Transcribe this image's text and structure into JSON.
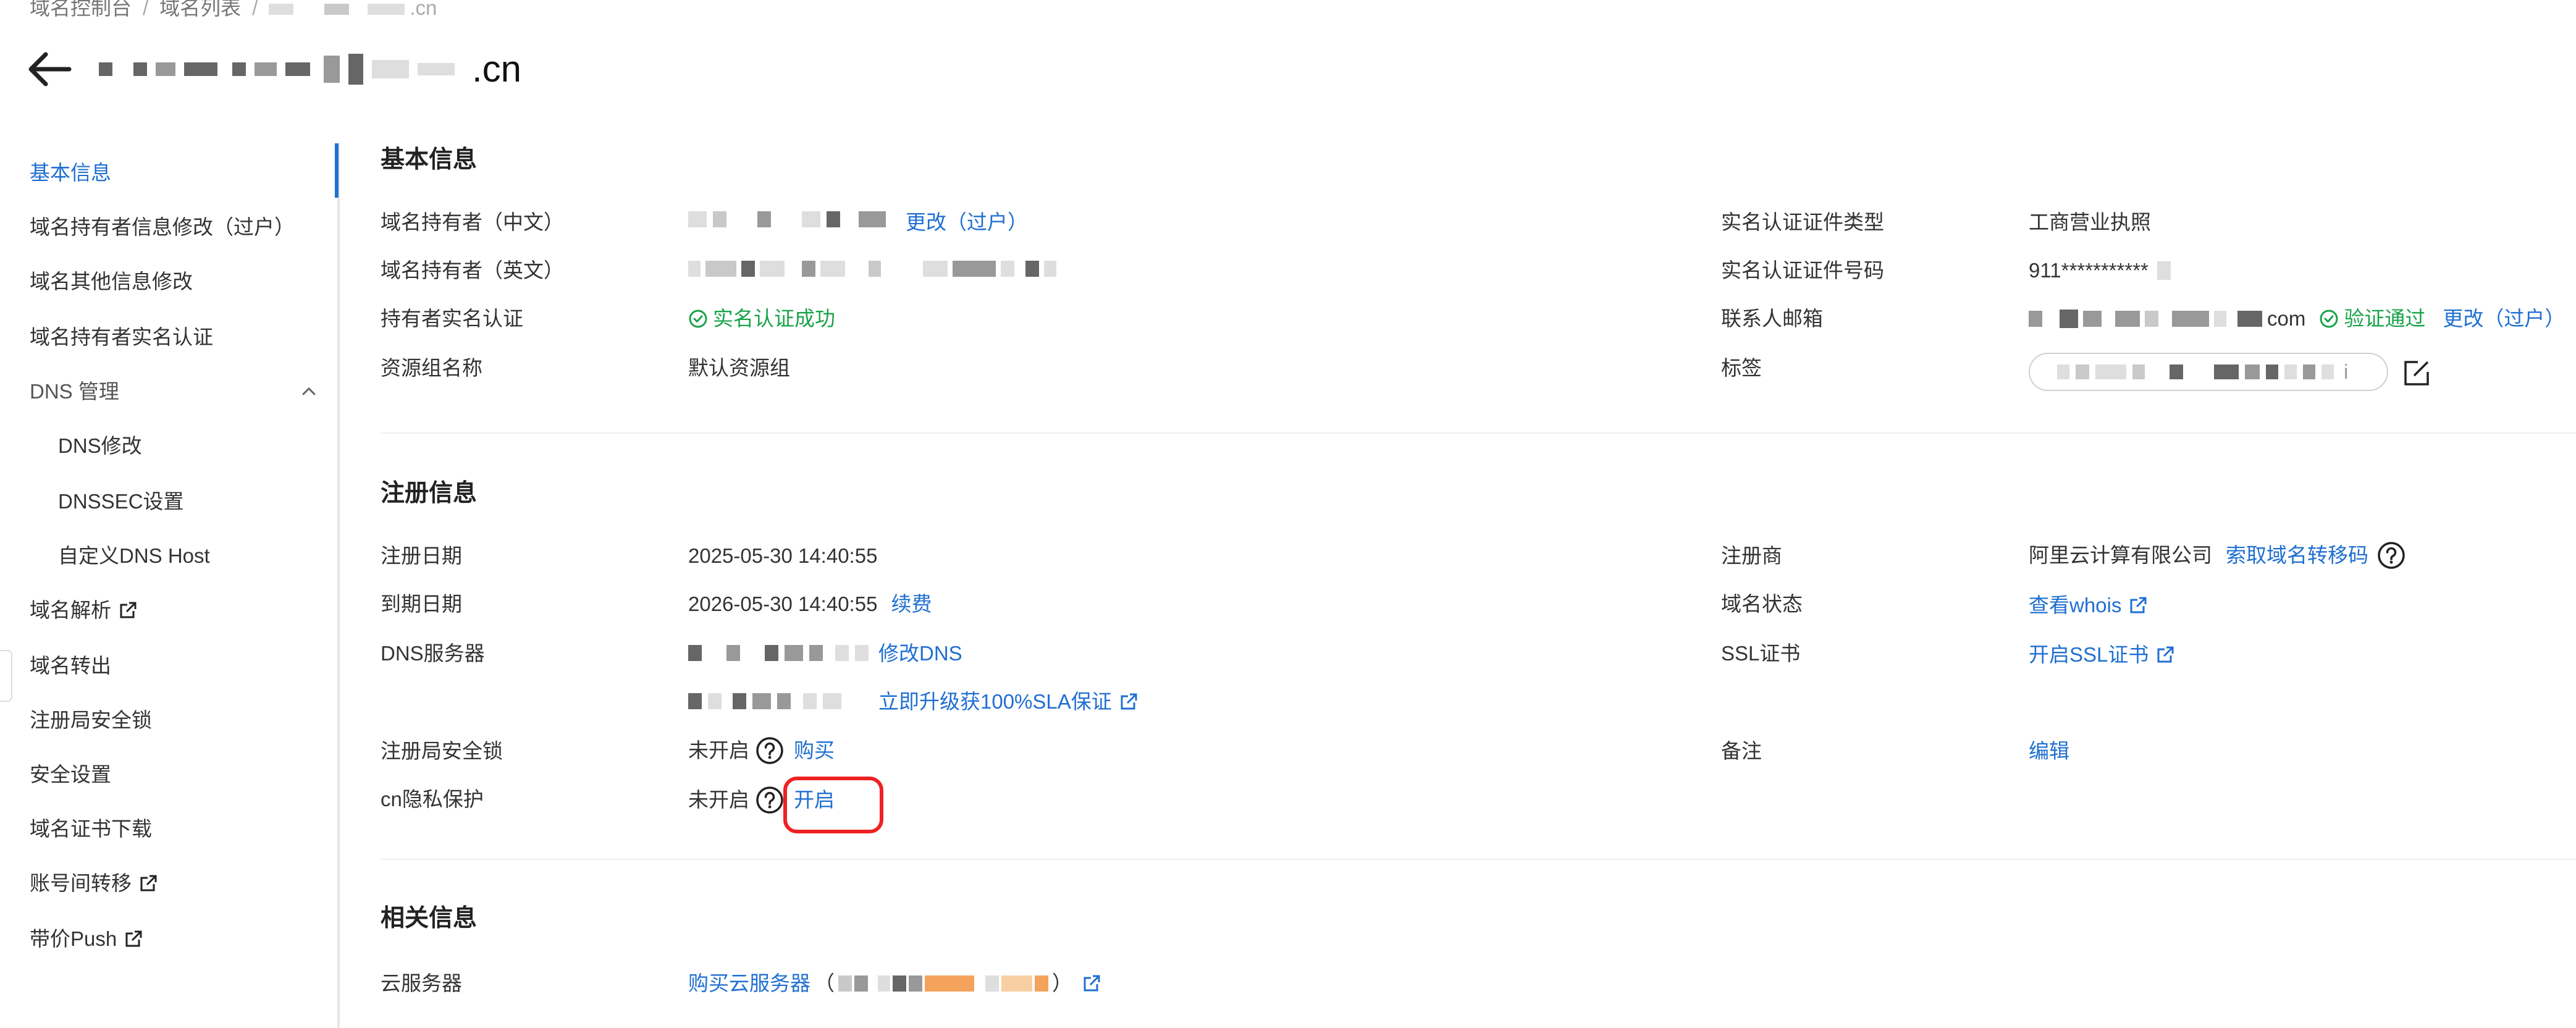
{
  "breadcrumb": {
    "item1": "域名控制台",
    "separator": "/",
    "item2": "域名列表",
    "item3_suffix": ".cn"
  },
  "header": {
    "title_suffix": ".cn"
  },
  "sidebar": {
    "items": [
      "基本信息",
      "域名持有者信息修改（过户）",
      "域名其他信息修改",
      "域名持有者实名认证",
      "DNS 管理",
      "DNS修改",
      "DNSSEC设置",
      "自定义DNS Host",
      "域名解析",
      "域名转出",
      "注册局安全锁",
      "安全设置",
      "域名证书下载",
      "账号间转移",
      "带价Push"
    ]
  },
  "basic": {
    "section_title": "基本信息",
    "owner_cn_label": "域名持有者（中文）",
    "owner_cn_action": "更改（过户）",
    "owner_en_label": "域名持有者（英文）",
    "realname_label": "持有者实名认证",
    "realname_value": "实名认证成功",
    "resgroup_label": "资源组名称",
    "resgroup_value": "默认资源组",
    "cert_type_label": "实名认证证件类型",
    "cert_type_value": "工商营业执照",
    "cert_no_label": "实名认证证件号码",
    "cert_no_value": "911***********",
    "email_label": "联系人邮箱",
    "email_suffix": "com",
    "email_verified": "验证通过",
    "email_action": "更改（过户）",
    "tag_label": "标签",
    "tag_suffix": "i"
  },
  "registration": {
    "section_title": "注册信息",
    "reg_date_label": "注册日期",
    "reg_date_value": "2025-05-30 14:40:55",
    "exp_date_label": "到期日期",
    "exp_date_value": "2026-05-30 14:40:55",
    "renew_action": "续费",
    "dns_label": "DNS服务器",
    "dns_action": "修改DNS",
    "sla_action": "立即升级获100%SLA保证",
    "lock_label": "注册局安全锁",
    "lock_value": "未开启",
    "lock_action": "购买",
    "privacy_label": "cn隐私保护",
    "privacy_value": "未开启",
    "privacy_action": "开启",
    "registrar_label": "注册商",
    "registrar_value": "阿里云计算有限公司",
    "registrar_action": "索取域名转移码",
    "status_label": "域名状态",
    "status_action": "查看whois",
    "ssl_label": "SSL证书",
    "ssl_action": "开启SSL证书",
    "remark_label": "备注",
    "remark_action": "编辑"
  },
  "related": {
    "section_title": "相关信息",
    "cloud_label": "云服务器",
    "cloud_action": "购买云服务器",
    "paren_open": "（",
    "paren_close": "）"
  },
  "colors": {
    "accent": "#1f6fd1",
    "success": "#1aa34a",
    "highlight": "#ee2222"
  }
}
